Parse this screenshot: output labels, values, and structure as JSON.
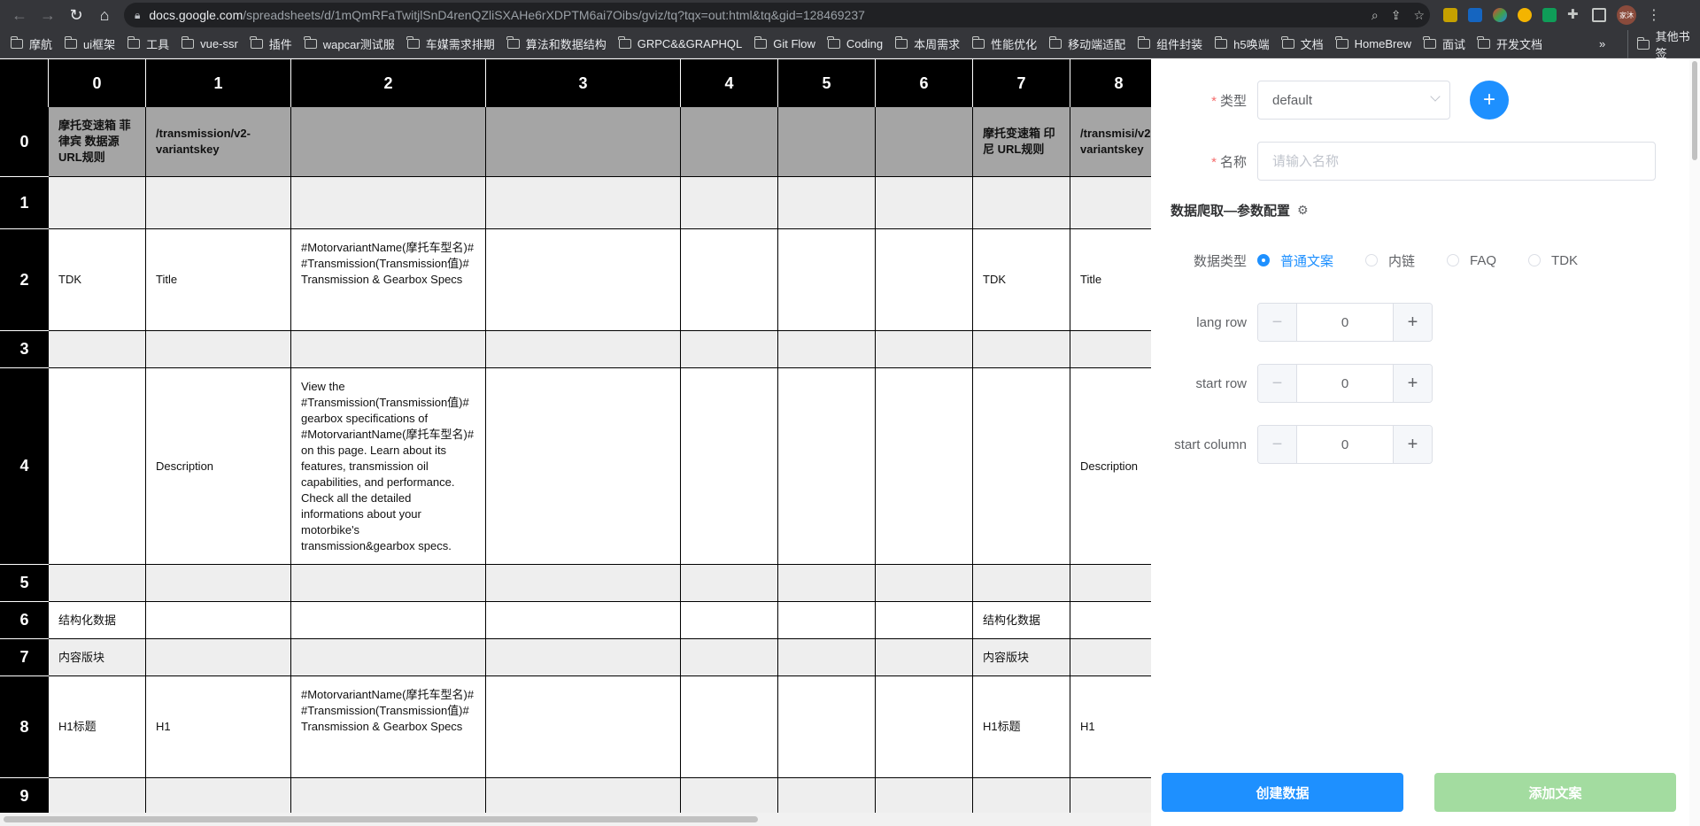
{
  "browser": {
    "url_domain": "docs.google.com",
    "url_path": "/spreadsheets/d/1mQmRFaTwitjlSnD4renQZliSXAHe6rXDPTM6ai7Oibs/gviz/tq?tqx=out:html&tq&gid=128469237",
    "profile_initials": "家沐",
    "bookmarks": [
      "摩航",
      "ui框架",
      "工具",
      "vue-ssr",
      "插件",
      "wapcar测试服",
      "车媒需求排期",
      "算法和数据结构",
      "GRPC&&GRAPHQL",
      "Git Flow",
      "Coding",
      "本周需求",
      "性能优化",
      "移动端适配",
      "组件封装",
      "h5唤端",
      "文档",
      "HomeBrew",
      "面试",
      "开发文档"
    ],
    "bookmarks_more": "»",
    "other_bookmarks": "其他书签"
  },
  "sheet": {
    "columns": [
      "0",
      "1",
      "2",
      "3",
      "4",
      "5",
      "6",
      "7",
      "8"
    ],
    "rows": [
      {
        "num": "0",
        "cells": [
          "摩托变速箱 菲律宾 数据源URL规则",
          "/transmission/v2-variantskey",
          "",
          "",
          "",
          "",
          "",
          "摩托变速箱 印尼 URL规则",
          "/transmisi/v2-variantskey"
        ]
      },
      {
        "num": "1",
        "cells": [
          "",
          "",
          "",
          "",
          "",
          "",
          "",
          "",
          ""
        ]
      },
      {
        "num": "2",
        "cells": [
          "TDK",
          "Title",
          "#MotorvariantName(摩托车型名)# #Transmission(Transmission值)# Transmission & Gearbox Specs",
          "",
          "",
          "",
          "",
          "TDK",
          "Title"
        ]
      },
      {
        "num": "3",
        "cells": [
          "",
          "",
          "",
          "",
          "",
          "",
          "",
          "",
          ""
        ]
      },
      {
        "num": "4",
        "cells": [
          "",
          "Description",
          "View the #Transmission(Transmission值)# gearbox specifications of #MotorvariantName(摩托车型名)# on this page. Learn about its features, transmission oil capabilities, and performance. Check all the detailed informations about your motorbike's transmission&gearbox specs.",
          "",
          "",
          "",
          "",
          "",
          "Description"
        ]
      },
      {
        "num": "5",
        "cells": [
          "",
          "",
          "",
          "",
          "",
          "",
          "",
          "",
          ""
        ]
      },
      {
        "num": "6",
        "cells": [
          "结构化数据",
          "",
          "",
          "",
          "",
          "",
          "",
          "结构化数据",
          ""
        ]
      },
      {
        "num": "7",
        "cells": [
          "内容版块",
          "",
          "",
          "",
          "",
          "",
          "",
          "内容版块",
          ""
        ]
      },
      {
        "num": "8",
        "cells": [
          "H1标题",
          "H1",
          "#MotorvariantName(摩托车型名)# #Transmission(Transmission值)# Transmission & Gearbox Specs",
          "",
          "",
          "",
          "",
          "H1标题",
          "H1"
        ]
      },
      {
        "num": "9",
        "cells": [
          "",
          "",
          "",
          "",
          "",
          "",
          "",
          "",
          ""
        ]
      }
    ]
  },
  "form": {
    "type_label": "类型",
    "type_value": "default",
    "name_label": "名称",
    "name_placeholder": "请输入名称",
    "section_title": "数据爬取—参数配置",
    "data_type_label": "数据类型",
    "data_type_options": [
      "普通文案",
      "内链",
      "FAQ",
      "TDK"
    ],
    "data_type_selected": "普通文案",
    "lang_row_label": "lang row",
    "lang_row_value": "0",
    "start_row_label": "start row",
    "start_row_value": "0",
    "start_column_label": "start column",
    "start_column_value": "0",
    "create_button": "创建数据",
    "add_copy_button": "添加文案"
  },
  "colors": {
    "primary": "#1e90ff",
    "required": "#f56c6c",
    "disabled_green": "#a3dca0",
    "sheet_header": "#000000",
    "row_header_bg": "#a5a5a5",
    "row_alt_bg": "#eeeeee"
  }
}
